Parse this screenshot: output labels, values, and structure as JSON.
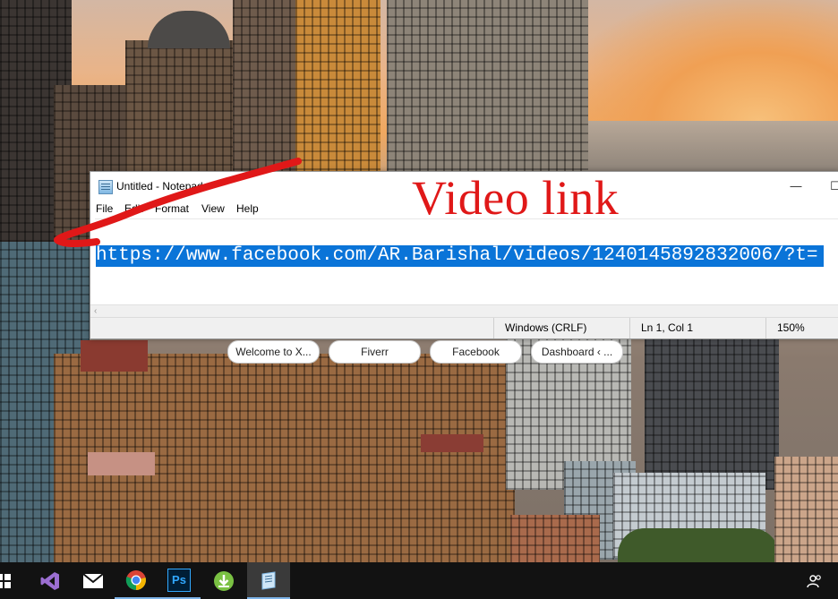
{
  "annotation": {
    "title": "Video link"
  },
  "notepad": {
    "title": "Untitled - Notepad",
    "controls": {
      "minimize": "—",
      "maximize": "☐"
    },
    "menu": [
      "File",
      "Edit",
      "Format",
      "View",
      "Help"
    ],
    "text": "https://www.facebook.com/AR.Barishal/videos/1240145892832006/?t=",
    "status": {
      "line_ending": "Windows (CRLF)",
      "position": "Ln 1, Col 1",
      "zoom": "150%"
    }
  },
  "tabs": [
    {
      "label": "Welcome to X..."
    },
    {
      "label": "Fiverr"
    },
    {
      "label": "Facebook"
    },
    {
      "label": "Dashboard ‹ ..."
    }
  ],
  "taskbar": {
    "icons": [
      "windows-start-icon",
      "visual-studio-icon",
      "mail-icon",
      "chrome-icon",
      "photoshop-icon",
      "idm-download-icon",
      "notepad-icon",
      "people-icon"
    ],
    "ps_label": "Ps"
  },
  "colors": {
    "annotation": "#e01818",
    "selection": "#0a74d8",
    "taskbar": "#121212"
  }
}
